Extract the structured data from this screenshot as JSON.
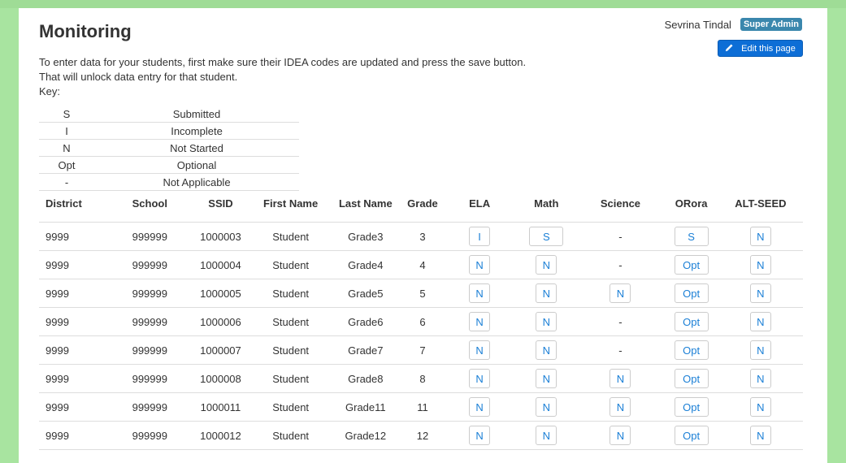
{
  "header": {
    "title": "Monitoring",
    "user_name": "Sevrina Tindal",
    "user_role": "Super Admin",
    "edit_label": "Edit this page"
  },
  "intro": {
    "line1": "To enter data for your students, first make sure their IDEA codes are updated and press the save button.",
    "line2": "That will unlock data entry for that student.",
    "key_label": "Key:"
  },
  "key": [
    {
      "code": "S",
      "meaning": "Submitted"
    },
    {
      "code": "I",
      "meaning": "Incomplete"
    },
    {
      "code": "N",
      "meaning": "Not Started"
    },
    {
      "code": "Opt",
      "meaning": "Optional"
    },
    {
      "code": "-",
      "meaning": "Not Applicable"
    }
  ],
  "columns": [
    "District",
    "School",
    "SSID",
    "First Name",
    "Last Name",
    "Grade",
    "ELA",
    "Math",
    "Science",
    "ORora",
    "ALT-SEED"
  ],
  "rows": [
    {
      "district": "9999",
      "school": "999999",
      "ssid": "1000003",
      "first": "Student",
      "last": "Grade3",
      "grade": "3",
      "ela": "I",
      "math": "S",
      "science": "-",
      "orora": "S",
      "alt": "N"
    },
    {
      "district": "9999",
      "school": "999999",
      "ssid": "1000004",
      "first": "Student",
      "last": "Grade4",
      "grade": "4",
      "ela": "N",
      "math": "N",
      "science": "-",
      "orora": "Opt",
      "alt": "N"
    },
    {
      "district": "9999",
      "school": "999999",
      "ssid": "1000005",
      "first": "Student",
      "last": "Grade5",
      "grade": "5",
      "ela": "N",
      "math": "N",
      "science": "N",
      "orora": "Opt",
      "alt": "N"
    },
    {
      "district": "9999",
      "school": "999999",
      "ssid": "1000006",
      "first": "Student",
      "last": "Grade6",
      "grade": "6",
      "ela": "N",
      "math": "N",
      "science": "-",
      "orora": "Opt",
      "alt": "N"
    },
    {
      "district": "9999",
      "school": "999999",
      "ssid": "1000007",
      "first": "Student",
      "last": "Grade7",
      "grade": "7",
      "ela": "N",
      "math": "N",
      "science": "-",
      "orora": "Opt",
      "alt": "N"
    },
    {
      "district": "9999",
      "school": "999999",
      "ssid": "1000008",
      "first": "Student",
      "last": "Grade8",
      "grade": "8",
      "ela": "N",
      "math": "N",
      "science": "N",
      "orora": "Opt",
      "alt": "N"
    },
    {
      "district": "9999",
      "school": "999999",
      "ssid": "1000011",
      "first": "Student",
      "last": "Grade11",
      "grade": "11",
      "ela": "N",
      "math": "N",
      "science": "N",
      "orora": "Opt",
      "alt": "N"
    },
    {
      "district": "9999",
      "school": "999999",
      "ssid": "1000012",
      "first": "Student",
      "last": "Grade12",
      "grade": "12",
      "ela": "N",
      "math": "N",
      "science": "N",
      "orora": "Opt",
      "alt": "N"
    }
  ],
  "colors": {
    "page_bg": "#a8e4a0",
    "badge": "#3a87ad",
    "edit_button": "#0d6ed6",
    "status_text": "#1a7fd6"
  },
  "icons": {
    "edit": "pencil-icon"
  }
}
